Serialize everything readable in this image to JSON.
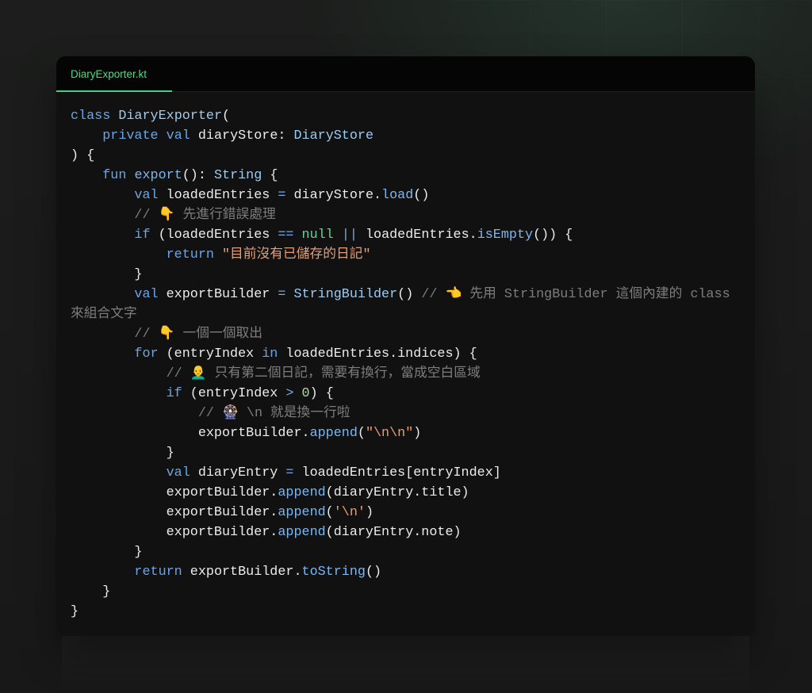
{
  "tab": {
    "label": "DiaryExporter.kt"
  },
  "theme": {
    "tab_accent": "#4ade80",
    "tab_underline": "#3fcf8e",
    "keyword": "#6aa6e6",
    "type": "#9ecbf0",
    "function": "#7eb6ee",
    "operator": "#7aa7e0",
    "literal": "#6ccf9a",
    "number": "#b5d6a7",
    "string": "#e39e77",
    "comment": "#7d7d7d",
    "text": "#ececec"
  },
  "editor": {
    "lines": [
      [
        {
          "kw": "class"
        },
        {
          "pl": " "
        },
        {
          "ty": "DiaryExporter"
        },
        {
          "pl": "("
        }
      ],
      [
        {
          "pl": "    "
        },
        {
          "kw": "private"
        },
        {
          "pl": " "
        },
        {
          "kw": "val"
        },
        {
          "pl": " diaryStore: "
        },
        {
          "ty": "DiaryStore"
        }
      ],
      [
        {
          "pl": ") {"
        }
      ],
      [
        {
          "pl": "    "
        },
        {
          "kw": "fun"
        },
        {
          "pl": " "
        },
        {
          "fn": "export"
        },
        {
          "pl": "(): "
        },
        {
          "ty": "String"
        },
        {
          "pl": " {"
        }
      ],
      [
        {
          "pl": "        "
        },
        {
          "kw": "val"
        },
        {
          "pl": " loadedEntries "
        },
        {
          "op": "="
        },
        {
          "pl": " diaryStore."
        },
        {
          "fn": "load"
        },
        {
          "pl": "()"
        }
      ],
      [
        {
          "pl": "        "
        },
        {
          "cm": "// 👇 先進行錯誤處理"
        }
      ],
      [
        {
          "pl": "        "
        },
        {
          "kw": "if"
        },
        {
          "pl": " (loadedEntries "
        },
        {
          "op": "=="
        },
        {
          "pl": " "
        },
        {
          "lit": "null"
        },
        {
          "pl": " "
        },
        {
          "op": "||"
        },
        {
          "pl": " loadedEntries."
        },
        {
          "fn": "isEmpty"
        },
        {
          "pl": "()) {"
        }
      ],
      [
        {
          "pl": "            "
        },
        {
          "kw": "return"
        },
        {
          "pl": " "
        },
        {
          "str": "\"目前沒有已儲存的日記\""
        }
      ],
      [
        {
          "pl": "        }"
        }
      ],
      [
        {
          "pl": "        "
        },
        {
          "kw": "val"
        },
        {
          "pl": " exportBuilder "
        },
        {
          "op": "="
        },
        {
          "pl": " "
        },
        {
          "ty": "StringBuilder"
        },
        {
          "pl": "() "
        },
        {
          "cm": "// 👈 先用 StringBuilder 這個內建的 class 來組合文字"
        }
      ],
      [
        {
          "pl": "        "
        },
        {
          "cm": "// 👇 一個一個取出"
        }
      ],
      [
        {
          "pl": "        "
        },
        {
          "kw": "for"
        },
        {
          "pl": " (entryIndex "
        },
        {
          "kw": "in"
        },
        {
          "pl": " loadedEntries.indices) {"
        }
      ],
      [
        {
          "pl": "            "
        },
        {
          "cm": "// 👨‍🦲 只有第二個日記，需要有換行，當成空白區域"
        }
      ],
      [
        {
          "pl": "            "
        },
        {
          "kw": "if"
        },
        {
          "pl": " (entryIndex "
        },
        {
          "op": ">"
        },
        {
          "pl": " "
        },
        {
          "num": "0"
        },
        {
          "pl": ") {"
        }
      ],
      [
        {
          "pl": "                "
        },
        {
          "cm": "// 🎡 \\n 就是換一行啦"
        }
      ],
      [
        {
          "pl": "                exportBuilder."
        },
        {
          "fn": "append"
        },
        {
          "pl": "("
        },
        {
          "str": "\"\\n\\n\""
        },
        {
          "pl": ")"
        }
      ],
      [
        {
          "pl": "            }"
        }
      ],
      [
        {
          "pl": "            "
        },
        {
          "kw": "val"
        },
        {
          "pl": " diaryEntry "
        },
        {
          "op": "="
        },
        {
          "pl": " loadedEntries[entryIndex]"
        }
      ],
      [
        {
          "pl": "            exportBuilder."
        },
        {
          "fn": "append"
        },
        {
          "pl": "(diaryEntry.title)"
        }
      ],
      [
        {
          "pl": "            exportBuilder."
        },
        {
          "fn": "append"
        },
        {
          "pl": "("
        },
        {
          "str": "'\\n'"
        },
        {
          "pl": ")"
        }
      ],
      [
        {
          "pl": "            exportBuilder."
        },
        {
          "fn": "append"
        },
        {
          "pl": "(diaryEntry.note)"
        }
      ],
      [
        {
          "pl": "        }"
        }
      ],
      [
        {
          "pl": "        "
        },
        {
          "kw": "return"
        },
        {
          "pl": " exportBuilder."
        },
        {
          "fn": "toString"
        },
        {
          "pl": "()"
        }
      ],
      [
        {
          "pl": "    }"
        }
      ],
      [
        {
          "pl": "}"
        }
      ]
    ]
  }
}
